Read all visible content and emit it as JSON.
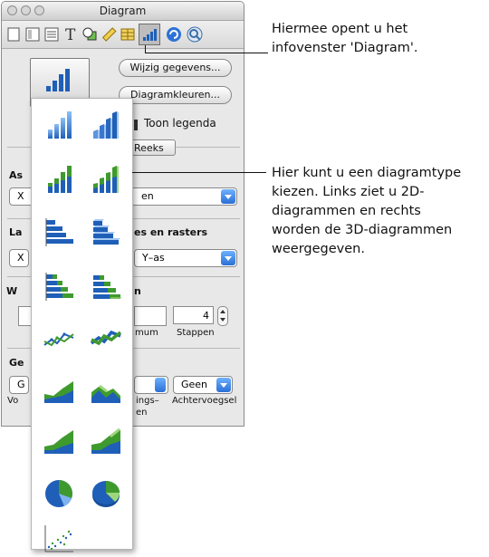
{
  "window": {
    "title": "Diagram"
  },
  "toolbar": {
    "icons": [
      "document-icon",
      "layout-icon",
      "wrap-icon",
      "text-icon",
      "graphic-icon",
      "metrics-icon",
      "table-icon",
      "chart-icon",
      "link-icon",
      "quicktime-icon"
    ],
    "active_icon": "chart-icon"
  },
  "chart_inspector": {
    "edit_data_label": "Wijzig gegevens...",
    "colors_label": "Diagramkleuren...",
    "show_legend_label": "Toon legenda",
    "series_tab_label": "Reeks",
    "axis_section_prefix": "As",
    "axis_popup_value_prefix": "X",
    "axis_popup_value_suffix": "en",
    "labels_section_prefix": "La",
    "labels_section_suffix": "es en rasters",
    "labels_popup_value": "Y–as",
    "labels_left_popup_prefix": "X",
    "value_section_prefix": "W",
    "value_section_suffix": "n",
    "steps_value": "4",
    "min_label_suffix": "mum",
    "steps_label": "Stappen",
    "format_section_prefix": "Ge",
    "format_popup_prefix": "G",
    "prefix_label_prefix": "Vo",
    "separator_label_top": "ings–",
    "separator_label_bottom": "en",
    "suffix_popup_value": "Geen",
    "suffix_label": "Achtervoegsel"
  },
  "chart_type_palette": {
    "left_column": "2D",
    "right_column": "3D",
    "types": [
      "bar-vertical",
      "bar-vertical-stacked",
      "bar-horizontal",
      "bar-horizontal-stacked",
      "line",
      "area",
      "area-stacked",
      "pie",
      "scatter"
    ]
  },
  "callouts": {
    "top": [
      "Hiermee opent u het",
      "infovenster 'Diagram'."
    ],
    "middle": [
      "Hier kunt u een diagramtype",
      "kiezen. Links ziet u 2D-",
      "diagrammen en rechts",
      "worden de 3D-diagrammen",
      "weergegeven."
    ]
  },
  "colors": {
    "blue_light": "#7fb3ef",
    "blue_dark": "#1f5fb8",
    "green": "#3f9a2e",
    "green_light": "#9ed77b"
  }
}
